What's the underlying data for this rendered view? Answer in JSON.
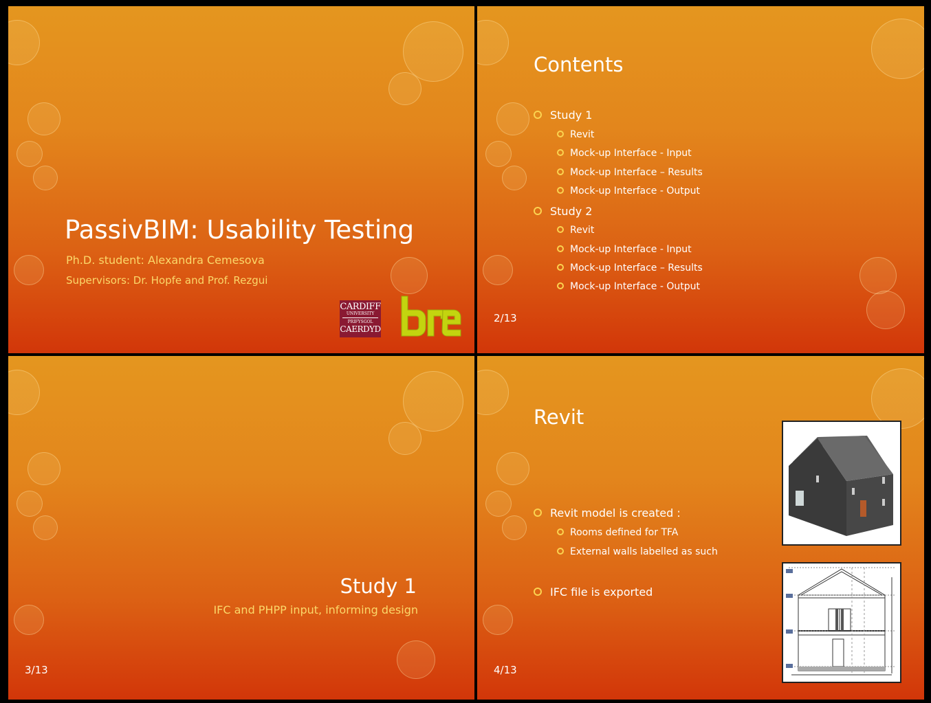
{
  "slides": [
    {
      "title": "PassivBIM:  Usability Testing",
      "subtitle_1": "Ph.D. student: Alexandra Cemesova",
      "subtitle_2": "Supervisors: Dr. Hopfe and Prof. Rezgui",
      "logos": {
        "cardiff": {
          "line1": "CARDIFF",
          "line2": "UNIVERSITY",
          "line3": "PRIFYSGOL",
          "line4": "CAERDYD"
        },
        "bre": "bre"
      }
    },
    {
      "title": "Contents",
      "items": [
        {
          "level": 1,
          "text": "Study 1"
        },
        {
          "level": 2,
          "text": "Revit"
        },
        {
          "level": 2,
          "text": "Mock-up Interface - Input"
        },
        {
          "level": 2,
          "text": "Mock-up Interface – Results"
        },
        {
          "level": 2,
          "text": "Mock-up Interface - Output"
        },
        {
          "level": 1,
          "text": "Study 2"
        },
        {
          "level": 2,
          "text": "Revit"
        },
        {
          "level": 2,
          "text": "Mock-up Interface - Input"
        },
        {
          "level": 2,
          "text": "Mock-up Interface – Results"
        },
        {
          "level": 2,
          "text": "Mock-up Interface - Output"
        }
      ],
      "page_number": "2/13"
    },
    {
      "title": "Study 1",
      "subtitle": "IFC and PHPP input, informing design",
      "page_number": "3/13"
    },
    {
      "title": "Revit",
      "items": [
        {
          "level": 1,
          "text": "Revit model is created :"
        },
        {
          "level": 2,
          "text": "Rooms defined for TFA"
        },
        {
          "level": 2,
          "text": "External walls labelled as such"
        },
        {
          "level": 1,
          "text": "IFC file is exported"
        }
      ],
      "images": [
        "house-3d-model",
        "house-section-drawing"
      ],
      "page_number": "4/13"
    }
  ],
  "colors": {
    "background_top": "#e4961f",
    "background_bottom": "#d23609",
    "accent_yellow": "#fbd86a",
    "bullet": "#fbd350",
    "cardiff_red": "#8a1932",
    "bre_green": "#c3d40f"
  }
}
